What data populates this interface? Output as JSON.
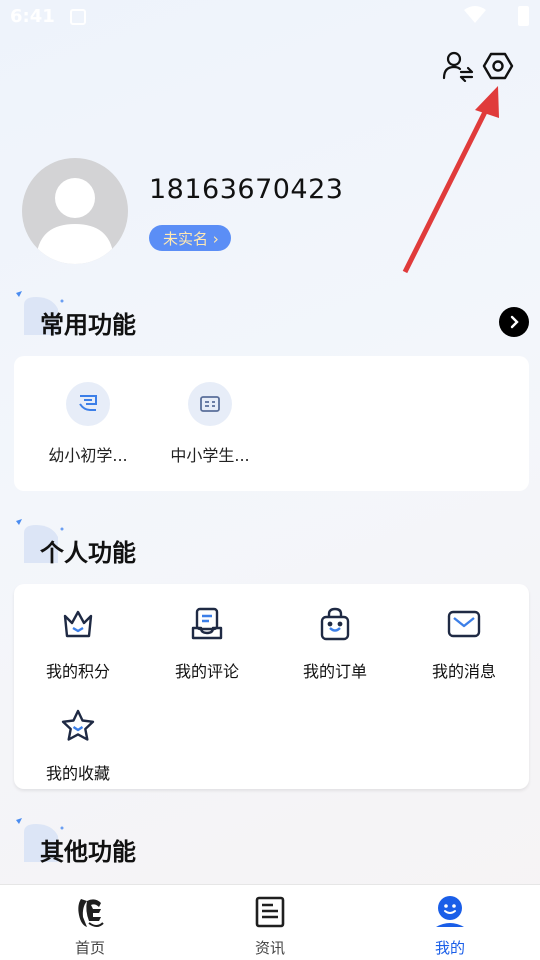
{
  "status_bar": {
    "time": "6:41"
  },
  "profile": {
    "phone": "18163670423",
    "verify_label": "未实名 ›"
  },
  "sections": {
    "common": {
      "title": "常用功能"
    },
    "personal": {
      "title": "个人功能"
    },
    "other": {
      "title": "其他功能"
    }
  },
  "common_items": [
    {
      "label": "幼小初学...",
      "icon": "hand-book-icon"
    },
    {
      "label": "中小学生...",
      "icon": "id-card-icon"
    }
  ],
  "personal_items": [
    {
      "label": "我的积分",
      "icon": "crown-icon"
    },
    {
      "label": "我的评论",
      "icon": "comment-tray-icon"
    },
    {
      "label": "我的订单",
      "icon": "shopping-bag-icon"
    },
    {
      "label": "我的消息",
      "icon": "mail-icon"
    },
    {
      "label": "我的收藏",
      "icon": "star-icon"
    }
  ],
  "bottom_nav": [
    {
      "label": "首页",
      "icon": "home-logo-icon",
      "active": false
    },
    {
      "label": "资讯",
      "icon": "news-icon",
      "active": false
    },
    {
      "label": "我的",
      "icon": "profile-face-icon",
      "active": true
    }
  ],
  "colors": {
    "accent": "#1a5ee8",
    "badge_bg": "#5b8ef6",
    "badge_text": "#ffe9b3",
    "arrow": "#e03b3b"
  }
}
